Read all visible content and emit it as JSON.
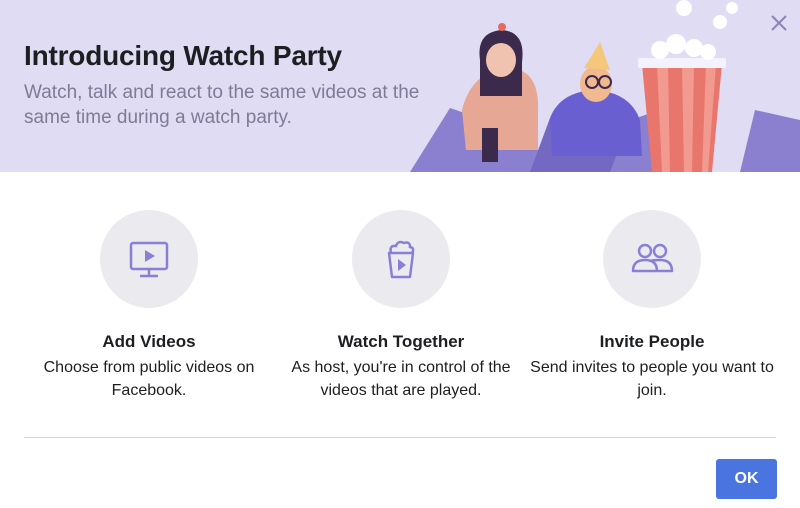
{
  "header": {
    "title": "Introducing Watch Party",
    "subtitle": "Watch, talk and react to the same videos at the same time during a watch party.",
    "close_icon": "close-icon"
  },
  "colors": {
    "header_bg": "#e0dcf3",
    "accent": "#8a7fd6",
    "button": "#4a75e0"
  },
  "features": [
    {
      "icon": "monitor-play-icon",
      "title": "Add Videos",
      "description": "Choose from public videos on Facebook."
    },
    {
      "icon": "popcorn-play-icon",
      "title": "Watch Together",
      "description": "As host, you're in control of the videos that are played."
    },
    {
      "icon": "people-icon",
      "title": "Invite People",
      "description": "Send invites to people you want to join."
    }
  ],
  "footer": {
    "ok_label": "OK"
  }
}
